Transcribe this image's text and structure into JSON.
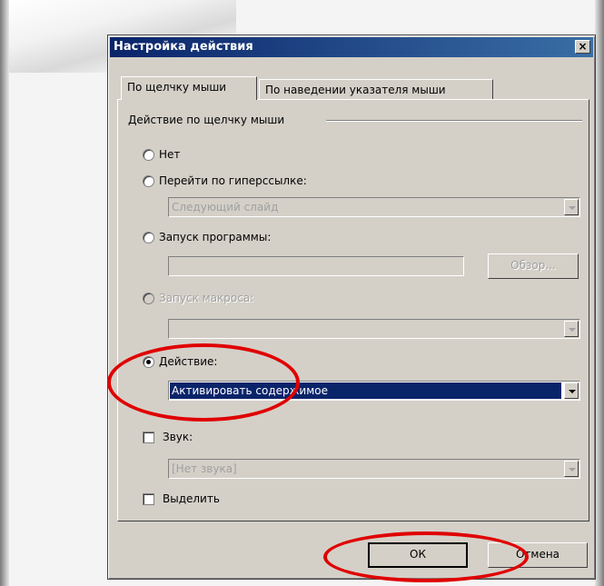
{
  "dialog": {
    "title": "Настройка действия",
    "close_glyph": "×"
  },
  "tabs": [
    {
      "label": "По щелчку мыши",
      "active": true
    },
    {
      "label": "По наведении указателя мыши",
      "active": false
    }
  ],
  "group": {
    "label": "Действие по щелчку мыши"
  },
  "options": {
    "none": {
      "label": "Нет",
      "selected": false
    },
    "hyperlink": {
      "label": "Перейти по гиперссылке:",
      "selected": false,
      "value": "Следующий слайд"
    },
    "program": {
      "label": "Запуск программы:",
      "selected": false,
      "value": "",
      "browse_label": "Обзор..."
    },
    "macro": {
      "label": "Запуск макроса:",
      "selected": false,
      "disabled": true,
      "value": ""
    },
    "action": {
      "label": "Действие:",
      "selected": true,
      "value": "Активировать содержимое"
    }
  },
  "sound": {
    "label": "Звук:",
    "checked": false,
    "value": "[Нет звука]"
  },
  "highlight": {
    "label": "Выделить",
    "checked": false
  },
  "buttons": {
    "ok_label": "ОК",
    "cancel_label": "Отмена"
  },
  "colors": {
    "titlebar_start": "#0a246a",
    "titlebar_end": "#3a6ea5",
    "selection": "#0a246a",
    "annotation": "#e00000",
    "dialog_face": "#d4d0c8"
  },
  "icons": {
    "close": "close-icon",
    "dropdown": "chevron-down-icon"
  }
}
